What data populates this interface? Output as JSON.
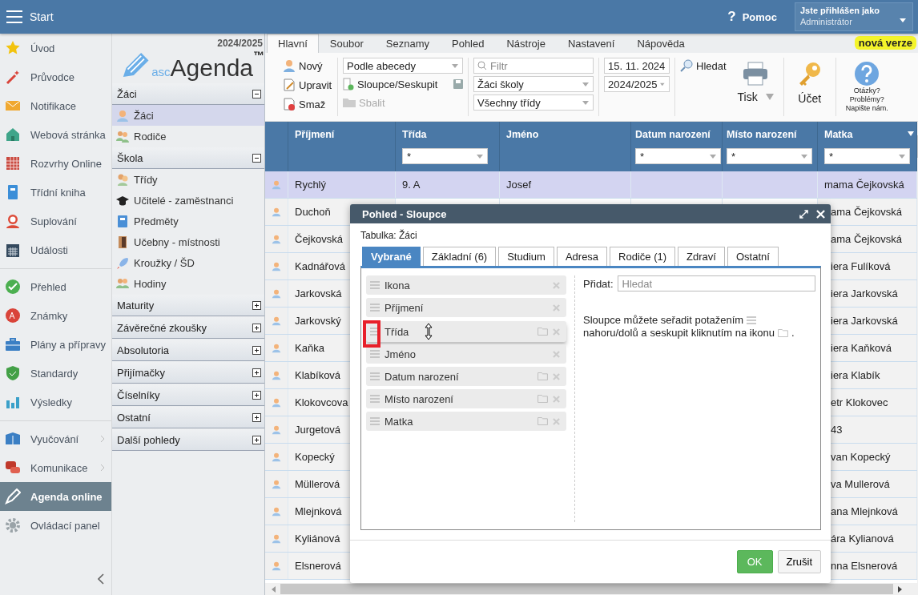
{
  "topbar": {
    "menu_label": "Start",
    "help_mark": "?",
    "help_label": "Pomoc",
    "user_caption": "Jste přihlášen jako",
    "user_name": "Administrátor"
  },
  "nav": {
    "groups": [
      {
        "items": [
          {
            "label": "Úvod",
            "selected": false,
            "submenu": false
          },
          {
            "label": "Průvodce",
            "selected": false,
            "submenu": false
          },
          {
            "label": "Notifikace",
            "selected": false,
            "submenu": false
          },
          {
            "label": "Webová stránka",
            "selected": false,
            "submenu": false
          },
          {
            "label": "Rozvrhy Online",
            "selected": false,
            "submenu": false
          },
          {
            "label": "Třídní kniha",
            "selected": false,
            "submenu": false
          },
          {
            "label": "Suplování",
            "selected": false,
            "submenu": false
          },
          {
            "label": "Události",
            "selected": false,
            "submenu": false
          }
        ]
      },
      {
        "items": [
          {
            "label": "Přehled",
            "selected": false,
            "submenu": false
          },
          {
            "label": "Známky",
            "selected": false,
            "submenu": false
          },
          {
            "label": "Plány a přípravy",
            "selected": false,
            "submenu": false
          },
          {
            "label": "Standardy",
            "selected": false,
            "submenu": false
          },
          {
            "label": "Výsledky",
            "selected": false,
            "submenu": false
          }
        ]
      },
      {
        "items": [
          {
            "label": "Vyučování",
            "selected": false,
            "submenu": true
          },
          {
            "label": "Komunikace",
            "selected": false,
            "submenu": true
          },
          {
            "label": "Agenda online",
            "selected": true,
            "submenu": false
          },
          {
            "label": "Ovládací panel",
            "selected": false,
            "submenu": false
          }
        ]
      }
    ]
  },
  "sidebar": {
    "year": "2024/2025",
    "logo": {
      "prefix": "asc",
      "name": "Agenda",
      "mark": "™"
    },
    "sections": [
      {
        "title": "Žáci",
        "expanded": true,
        "items": [
          {
            "label": "Žáci",
            "selected": true
          },
          {
            "label": "Rodiče",
            "selected": false
          }
        ]
      },
      {
        "title": "Škola",
        "expanded": true,
        "items": [
          {
            "label": "Třídy",
            "selected": false
          },
          {
            "label": "Učitelé - zaměstnanci",
            "selected": false
          },
          {
            "label": "Předměty",
            "selected": false
          },
          {
            "label": "Učebny - místnosti",
            "selected": false
          },
          {
            "label": "Kroužky / ŠD",
            "selected": false
          },
          {
            "label": "Hodiny",
            "selected": false
          }
        ]
      },
      {
        "title": "Maturity",
        "expanded": false
      },
      {
        "title": "Závěrečné zkoušky",
        "expanded": false
      },
      {
        "title": "Absolutoria",
        "expanded": false
      },
      {
        "title": "Přijímačky",
        "expanded": false
      },
      {
        "title": "Číselníky",
        "expanded": false
      },
      {
        "title": "Ostatní",
        "expanded": false
      },
      {
        "title": "Další pohledy",
        "expanded": false
      }
    ]
  },
  "tabs": [
    {
      "label": "Hlavní",
      "selected": true
    },
    {
      "label": "Soubor",
      "selected": false
    },
    {
      "label": "Seznamy",
      "selected": false
    },
    {
      "label": "Pohled",
      "selected": false
    },
    {
      "label": "Nástroje",
      "selected": false
    },
    {
      "label": "Nastavení",
      "selected": false
    },
    {
      "label": "Nápověda",
      "selected": false
    }
  ],
  "new_version_badge": "nová verze",
  "toolbar": {
    "actions": [
      "Nový",
      "Upravit",
      "Smaž"
    ],
    "sort_select": "Podle abecedy",
    "columns_button": "Sloupce/Seskupit",
    "collapse_button": {
      "label": "Sbalit",
      "disabled": true
    },
    "filter": {
      "placeholder": "Filtr"
    },
    "scope_select": "Žáci školy",
    "class_select": "Všechny třídy",
    "date": "15. 11. 2024",
    "year_select": "2024/2025",
    "search_button": "Hledat",
    "print_button": "Tisk",
    "account_button": "Účet",
    "help_lines": [
      "Otázky?",
      "Problémy?",
      "Napište nám."
    ]
  },
  "table": {
    "columns": [
      {
        "label": "Příjmení"
      },
      {
        "label": "Třída",
        "filter": "*"
      },
      {
        "label": "Jméno"
      },
      {
        "label": "Datum narození",
        "filter": "*"
      },
      {
        "label": "Místo narození",
        "filter": "*"
      },
      {
        "label": "Matka",
        "filter": "*"
      }
    ],
    "rows": [
      {
        "surname": "Rychlý",
        "class": "9. A",
        "name": "Josef",
        "mother": "mama Čejkovská",
        "selected": true
      },
      {
        "surname": "Duchoň",
        "mother": "ama Čejkovská",
        "selected": false
      },
      {
        "surname": "Čejkovská",
        "mother": "ama Čejkovská",
        "selected": false
      },
      {
        "surname": "Kadnářová",
        "mother": "iera Fulíková",
        "selected": false
      },
      {
        "surname": "Jarkovská",
        "mother": "iera Jarkovská",
        "selected": false
      },
      {
        "surname": "Jarkovský",
        "mother": "iera Jarkovská",
        "selected": false
      },
      {
        "surname": "Kaňka",
        "mother": "iera Kaňková",
        "selected": false
      },
      {
        "surname": "Klabíková",
        "mother": "iera Klabík",
        "selected": false
      },
      {
        "surname": "Klokovcova",
        "mother": "etr Klokovec",
        "selected": false
      },
      {
        "surname": "Jurgetová",
        "mother": "43",
        "selected": false
      },
      {
        "surname": "Kopecký",
        "mother": "van Kopecký",
        "selected": false
      },
      {
        "surname": "Müllerová",
        "mother": "va Mullerová",
        "selected": false
      },
      {
        "surname": "Mlejnková",
        "mother": "ana Mlejnková",
        "selected": false
      },
      {
        "surname": "Kyliánová",
        "mother": "ára Kylianová",
        "selected": false
      },
      {
        "surname": "Elsnerová",
        "mother": "nna Elsnerová",
        "selected": false
      }
    ]
  },
  "dialog": {
    "title": "Pohled - Sloupce",
    "table_label": "Tabulka: Žáci",
    "tabs": [
      {
        "label": "Vybrané",
        "selected": true
      },
      {
        "label": "Základní (6)",
        "selected": false
      },
      {
        "label": "Studium",
        "selected": false
      },
      {
        "label": "Adresa",
        "selected": false
      },
      {
        "label": "Rodiče (1)",
        "selected": false
      },
      {
        "label": "Zdraví",
        "selected": false
      },
      {
        "label": "Ostatní",
        "selected": false
      }
    ],
    "columns": [
      {
        "label": "Ikona",
        "groupable": false,
        "dragging": false
      },
      {
        "label": "Příjmení",
        "groupable": false,
        "dragging": false
      },
      {
        "label": "Třída",
        "groupable": true,
        "dragging": true
      },
      {
        "label": "Jméno",
        "groupable": false,
        "dragging": false
      },
      {
        "label": "Datum narození",
        "groupable": true,
        "dragging": false
      },
      {
        "label": "Místo narození",
        "groupable": true,
        "dragging": false
      },
      {
        "label": "Matka",
        "groupable": true,
        "dragging": false
      }
    ],
    "add_label": "Přidat:",
    "add_search": {
      "placeholder": "Hledat"
    },
    "hint_parts": [
      "Sloupce můžete seřadit potažením",
      "nahoru/dolů a",
      "seskupit kliknutím na ikonu",
      "."
    ],
    "ok_button": "OK",
    "cancel_button": "Zrušit"
  }
}
